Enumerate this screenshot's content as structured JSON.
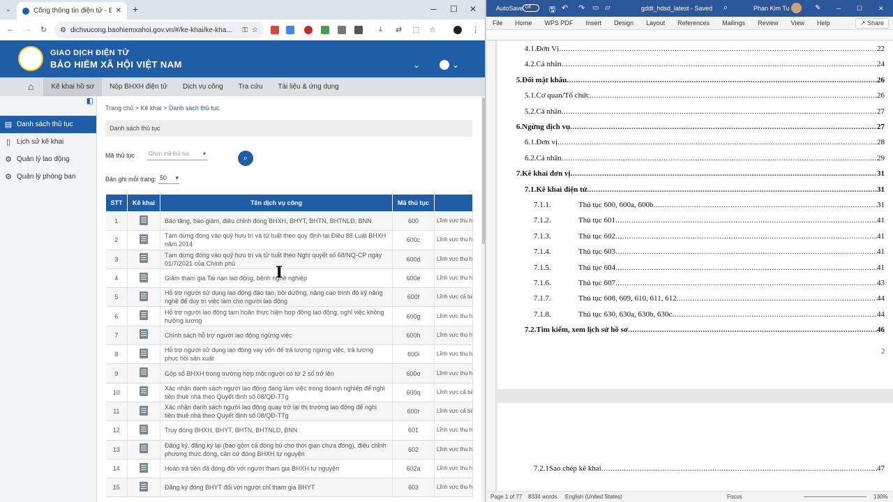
{
  "browser": {
    "tab_title": "Cổng thông tin điện tử - Bảo hi...",
    "url": "dichvucong.baohiemxahoi.gov.vn/#/ke-khai/ke-kha...",
    "site": {
      "brand_line1": "GIAO DỊCH ĐIỆN TỬ",
      "brand_line2": "BẢO HIỂM XÃ HỘI VIỆT NAM",
      "nav": [
        "Kê khai hồ sơ",
        "Nộp BHXH điện tử",
        "Dịch vụ công",
        "Tra cứu",
        "Tài liệu & ứng dụng"
      ],
      "sidebar": [
        "Danh sách thủ tục",
        "Lịch sử kê khai",
        "Quản lý lao động",
        "Quản lý phòng ban"
      ],
      "breadcrumb": {
        "home": "Trang chủ",
        "sep1": ">",
        "mid": "Kê khai",
        "sep2": ">",
        "current": "Danh sách thủ tục"
      },
      "page_title": "Danh sách thủ tục",
      "filter_label": "Mã thủ tục",
      "filter_placeholder": "Chọn mã thủ tục",
      "page_size_label": "Bản ghi mỗi trang:",
      "page_size_value": "50",
      "table": {
        "headers": [
          "STT",
          "Kê khai",
          "Tên dịch vụ công",
          "Mã thủ tục",
          ""
        ],
        "rows": [
          {
            "stt": "1",
            "name": "Báo tăng, báo giảm, điều chỉnh đóng BHXH, BHYT, BHTN, BHTNLĐ, BNN",
            "code": "600",
            "field": "Lĩnh vực thu hiểm y tế, b"
          },
          {
            "stt": "2",
            "name": "Tạm dừng đóng vào quỹ hưu trí và tử tuất theo quy định tại Điều 88 Luật BHXH năm 2014",
            "code": "600c",
            "field": "Lĩnh vực thu hiểm y tế, b"
          },
          {
            "stt": "3",
            "name": "Tạm dừng đóng vào quỹ hưu trí và tử tuất theo Nghị quyết số 68/NQ-CP ngày 01/7/2021 của Chính phủ",
            "code": "600d",
            "field": "Lĩnh vực thu hiểm y tế, b"
          },
          {
            "stt": "4",
            "name": "Giảm tham gia Tai nạn lao động, bệnh nghề nghiệp",
            "code": "600e",
            "field": "Lĩnh vực thu hiểm y tế, b"
          },
          {
            "stt": "5",
            "name": "Hỗ trợ người sử dụng lao động đào tạo, bồi dưỡng, nâng cao trình độ kỹ năng nghề để duy trì việc làm cho người lao động",
            "code": "600f",
            "field": "Lĩnh vực cấ bảo hiểm y"
          },
          {
            "stt": "6",
            "name": "Hỗ trợ người lao động tạm hoãn thực hiện hợp đồng lao động, nghỉ việc không hưởng lương",
            "code": "600g",
            "field": "Lĩnh vực thu hiểm y tế, b"
          },
          {
            "stt": "7",
            "name": "Chính sách hỗ trợ người lao động ngừng việc",
            "code": "600h",
            "field": "Lĩnh vực thu hiểm y tế, b"
          },
          {
            "stt": "8",
            "name": "Hỗ trợ người sử dụng lao động vay vốn để trả lương ngừng việc, trả lương phục hồi sản xuất",
            "code": "600i",
            "field": "Lĩnh vực thu hiểm y tế, b"
          },
          {
            "stt": "9",
            "name": "Gộp sổ BHXH trong trường hợp một người có từ 2 sổ trở lên",
            "code": "600o",
            "field": "Lĩnh vực thu hiểm y tế, b"
          },
          {
            "stt": "10",
            "name": "Xác nhận danh sách người lao động đang làm việc trong doanh nghiệp để nghị tiền thuê nhà theo Quyết định số 08/QĐ-TTg",
            "code": "600q",
            "field": "Lĩnh vực cấ bảo hiểm y"
          },
          {
            "stt": "11",
            "name": "Xác nhận danh sách người lao động quay trở lại thị trường lao động để nghị tiền thuê nhà theo Quyết định số 08/QĐ-TTg",
            "code": "600r",
            "field": "Lĩnh vực cấ bảo hiểm y"
          },
          {
            "stt": "12",
            "name": "Truy đóng BHXH, BHYT, BHTN, BHTNLĐ, BNN",
            "code": "601",
            "field": "Lĩnh vực thu hiểm y tế, b"
          },
          {
            "stt": "13",
            "name": "Đăng ký, đăng ký lại (bao gồm cả đóng bù cho thời gian chưa đóng), điều chỉnh phương thức đóng, căn cứ đóng BHXH tự nguyện",
            "code": "602",
            "field": "Lĩnh vực thu hiểm y tế, b"
          },
          {
            "stt": "14",
            "name": "Hoàn trả tiền đã đóng đối với người tham gia BHXH tự nguyện",
            "code": "602a",
            "field": "Lĩnh vực thu hiểm y tế, b"
          },
          {
            "stt": "15",
            "name": "Đăng ký đóng BHYT đối với người chỉ tham gia BHYT",
            "code": "603",
            "field": "Lĩnh vực thu hiểm y tế, b"
          }
        ]
      }
    }
  },
  "word": {
    "autosave_label": "AutoSave",
    "autosave_state": "Off",
    "doc_title": "gddt_hdsd_latest  -  Saved",
    "user": "Phan Kim Tu",
    "menu": [
      "File",
      "Home",
      "WPS PDF",
      "Insert",
      "Design",
      "Layout",
      "References",
      "Mailings",
      "Review",
      "View",
      "Help"
    ],
    "share_label": "Share",
    "toc": [
      {
        "num": "4.1. ",
        "text": "Đơn Vị",
        "page": "22",
        "bold": false,
        "indent": 39
      },
      {
        "num": "4.2. ",
        "text": "Cá nhân",
        "page": "24",
        "bold": false,
        "indent": 39
      },
      {
        "num": "5. ",
        "text": "Đổi mật khẩu",
        "page": "26",
        "bold": true,
        "indent": 27
      },
      {
        "num": "5.1. ",
        "text": "Cơ quan/Tổ chức",
        "page": "26",
        "bold": false,
        "indent": 39
      },
      {
        "num": "5.2. ",
        "text": "Cá nhân",
        "page": "27",
        "bold": false,
        "indent": 39
      },
      {
        "num": "6. ",
        "text": "Ngừng dịch vụ",
        "page": "27",
        "bold": true,
        "indent": 27
      },
      {
        "num": "6.1. ",
        "text": "Đơn vị",
        "page": "28",
        "bold": false,
        "indent": 39
      },
      {
        "num": "6.2. ",
        "text": "Cá nhân",
        "page": "29",
        "bold": false,
        "indent": 39
      },
      {
        "num": "7. ",
        "text": "Kê khai đơn vị",
        "page": "31",
        "bold": true,
        "indent": 27
      },
      {
        "num": "7.1. ",
        "text": "Kê khai điện tử",
        "page": "31",
        "bold": true,
        "indent": 39
      },
      {
        "num": "7.1.1.",
        "text": "Thủ tục 600, 600a, 600b",
        "page": "31",
        "bold": false,
        "indent": 52
      },
      {
        "num": "7.1.2.",
        "text": "Thủ tục 601",
        "page": "41",
        "bold": false,
        "indent": 52
      },
      {
        "num": "7.1.3.",
        "text": "Thủ tục 602",
        "page": "41",
        "bold": false,
        "indent": 52
      },
      {
        "num": "7.1.4.",
        "text": "Thủ tục 603",
        "page": "41",
        "bold": false,
        "indent": 52
      },
      {
        "num": "7.1.5.",
        "text": "Thủ tục 604",
        "page": "41",
        "bold": false,
        "indent": 52
      },
      {
        "num": "7.1.6.",
        "text": "Thủ tục 607",
        "page": "43",
        "bold": false,
        "indent": 52
      },
      {
        "num": "7.1.7.",
        "text": "Thủ tục 608, 609, 610, 611, 612",
        "page": "44",
        "bold": false,
        "indent": 52
      },
      {
        "num": "7.1.8.",
        "text": "Thủ tục 630, 630a, 630b, 630c",
        "page": "44",
        "bold": false,
        "indent": 52
      },
      {
        "num": "7.2. ",
        "text": "Tìm kiếm, xem lịch sử hồ sơ",
        "page": "46",
        "bold": true,
        "indent": 39
      }
    ],
    "page_frag": "2",
    "toc_page2": {
      "num": "7.2.1 ",
      "text": "Sao chép kê khai",
      "page": "47"
    },
    "status": {
      "page": "Page 1 of 77",
      "words": "8334 words",
      "lang": "English (United States)",
      "focus": "Focus",
      "zoom": "130%"
    }
  }
}
